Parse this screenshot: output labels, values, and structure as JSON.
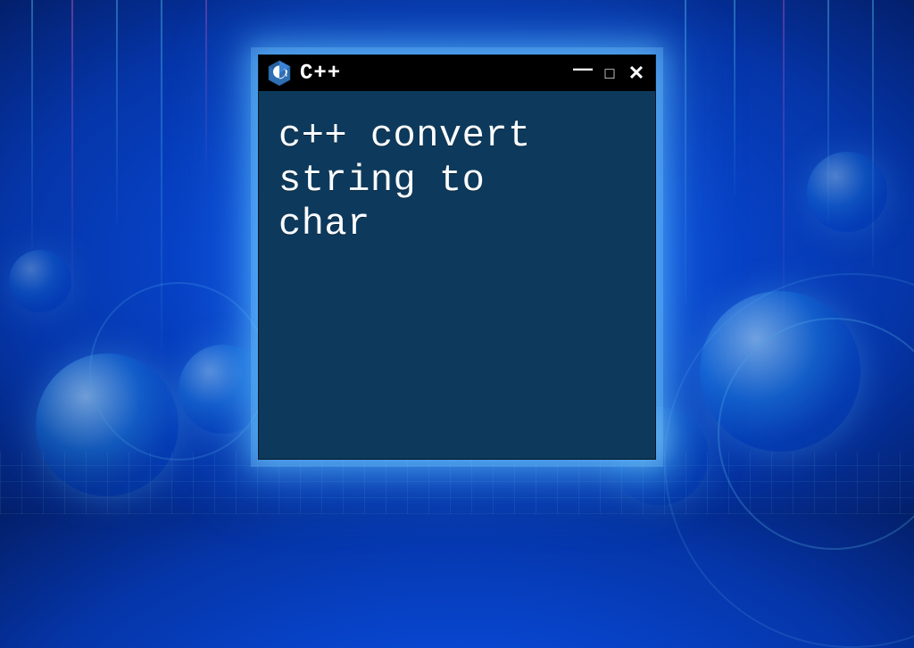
{
  "window": {
    "title": "C++",
    "icon": "cpp-logo-icon",
    "controls": {
      "minimize": "—",
      "maximize": "□",
      "close": "✕"
    }
  },
  "content": {
    "text": "c++ convert\nstring to\nchar"
  },
  "colors": {
    "titlebar_bg": "#000000",
    "window_bg": "#0d3a5c",
    "text": "#fafcff",
    "glow": "#78e6ff"
  }
}
